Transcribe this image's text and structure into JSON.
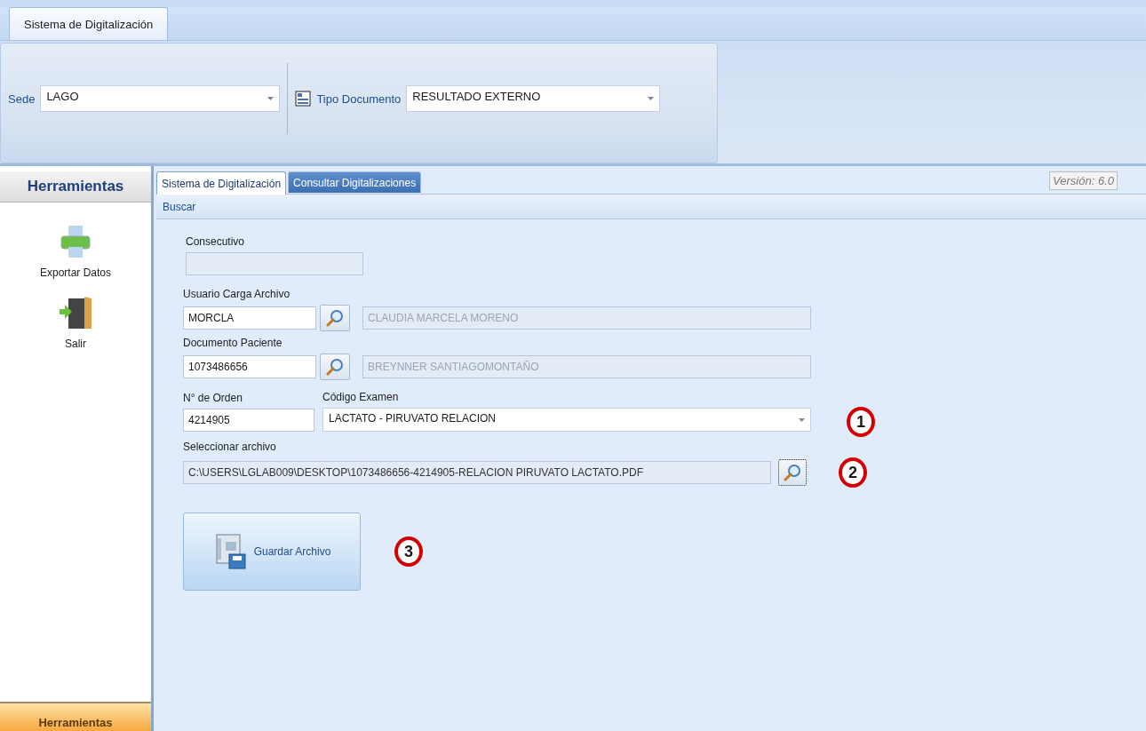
{
  "ribbon": {
    "tabs": [
      {
        "label": "Sistema de Digitalización",
        "selected": true
      }
    ],
    "fields": [
      {
        "label": "Sede",
        "value": "LAGO",
        "kind": "plain"
      },
      {
        "label": "Tipo Documento",
        "value": "RESULTADO EXTERNO",
        "kind": "icon"
      }
    ]
  },
  "sidebar": {
    "title": "Herramientas",
    "items": [
      {
        "label": "Exportar Datos",
        "kind": "printer"
      },
      {
        "label": "Salir",
        "kind": "exit"
      }
    ],
    "footer": "Herramientas"
  },
  "tabs": [
    {
      "label": "Sistema de Digitalización",
      "selected": true,
      "highlighted": false
    },
    {
      "label": "Consultar Digitalizaciones",
      "selected": false,
      "highlighted": true
    }
  ],
  "version": "Versión: 6.0",
  "section": "Buscar",
  "form": {
    "consecutivo": {
      "label": "Consecutivo"
    },
    "usuario": {
      "label": "Usuario Carga Archivo",
      "value": "MORCLA",
      "name": "CLAUDIA MARCELA MORENO"
    },
    "paciente": {
      "label": "Documento Paciente",
      "value": "1073486656",
      "name": "BREYNNER SANTIAGOMONTAÑO"
    },
    "orden": {
      "label": "N° de Orden",
      "value": "4214905"
    },
    "examen": {
      "label": "Código Examen",
      "value": "LACTATO - PIRUVATO RELACION",
      "callout": "1"
    },
    "archivo": {
      "label": "Seleccionar archivo",
      "value": "C:\\USERS\\LGLAB009\\DESKTOP\\1073486656-4214905-RELACION PIRUVATO LACTATO.PDF",
      "callout": "2"
    },
    "save": {
      "label": "Guardar Archivo",
      "callout": "3"
    }
  }
}
